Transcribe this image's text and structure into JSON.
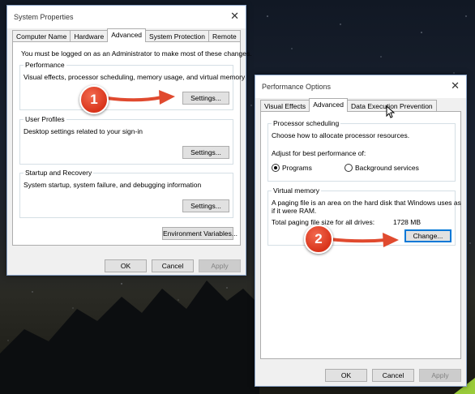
{
  "system_properties": {
    "title": "System Properties",
    "tabs": [
      "Computer Name",
      "Hardware",
      "Advanced",
      "System Protection",
      "Remote"
    ],
    "active_tab": "Advanced",
    "admin_note": "You must be logged on as an Administrator to make most of these changes.",
    "performance": {
      "title": "Performance",
      "desc": "Visual effects, processor scheduling, memory usage, and virtual memory",
      "button": "Settings..."
    },
    "user_profiles": {
      "title": "User Profiles",
      "desc": "Desktop settings related to your sign-in",
      "button": "Settings..."
    },
    "startup": {
      "title": "Startup and Recovery",
      "desc": "System startup, system failure, and debugging information",
      "button": "Settings..."
    },
    "env_button": "Environment Variables...",
    "ok": "OK",
    "cancel": "Cancel",
    "apply": "Apply"
  },
  "performance_options": {
    "title": "Performance Options",
    "tabs": [
      "Visual Effects",
      "Advanced",
      "Data Execution Prevention"
    ],
    "active_tab": "Advanced",
    "processor": {
      "title": "Processor scheduling",
      "desc": "Choose how to allocate processor resources.",
      "adjust_label": "Adjust for best performance of:",
      "option_programs": "Programs",
      "option_background": "Background services",
      "selected": "Programs"
    },
    "virtual_memory": {
      "title": "Virtual memory",
      "desc_line1": "A paging file is an area on the hard disk that Windows uses as",
      "desc_line2": "if it were RAM.",
      "total_label": "Total paging file size for all drives:",
      "total_value": "1728 MB",
      "button": "Change..."
    },
    "ok": "OK",
    "cancel": "Cancel",
    "apply": "Apply"
  },
  "annotations": {
    "step1": "1",
    "step2": "2",
    "color": "#e04a2f"
  }
}
